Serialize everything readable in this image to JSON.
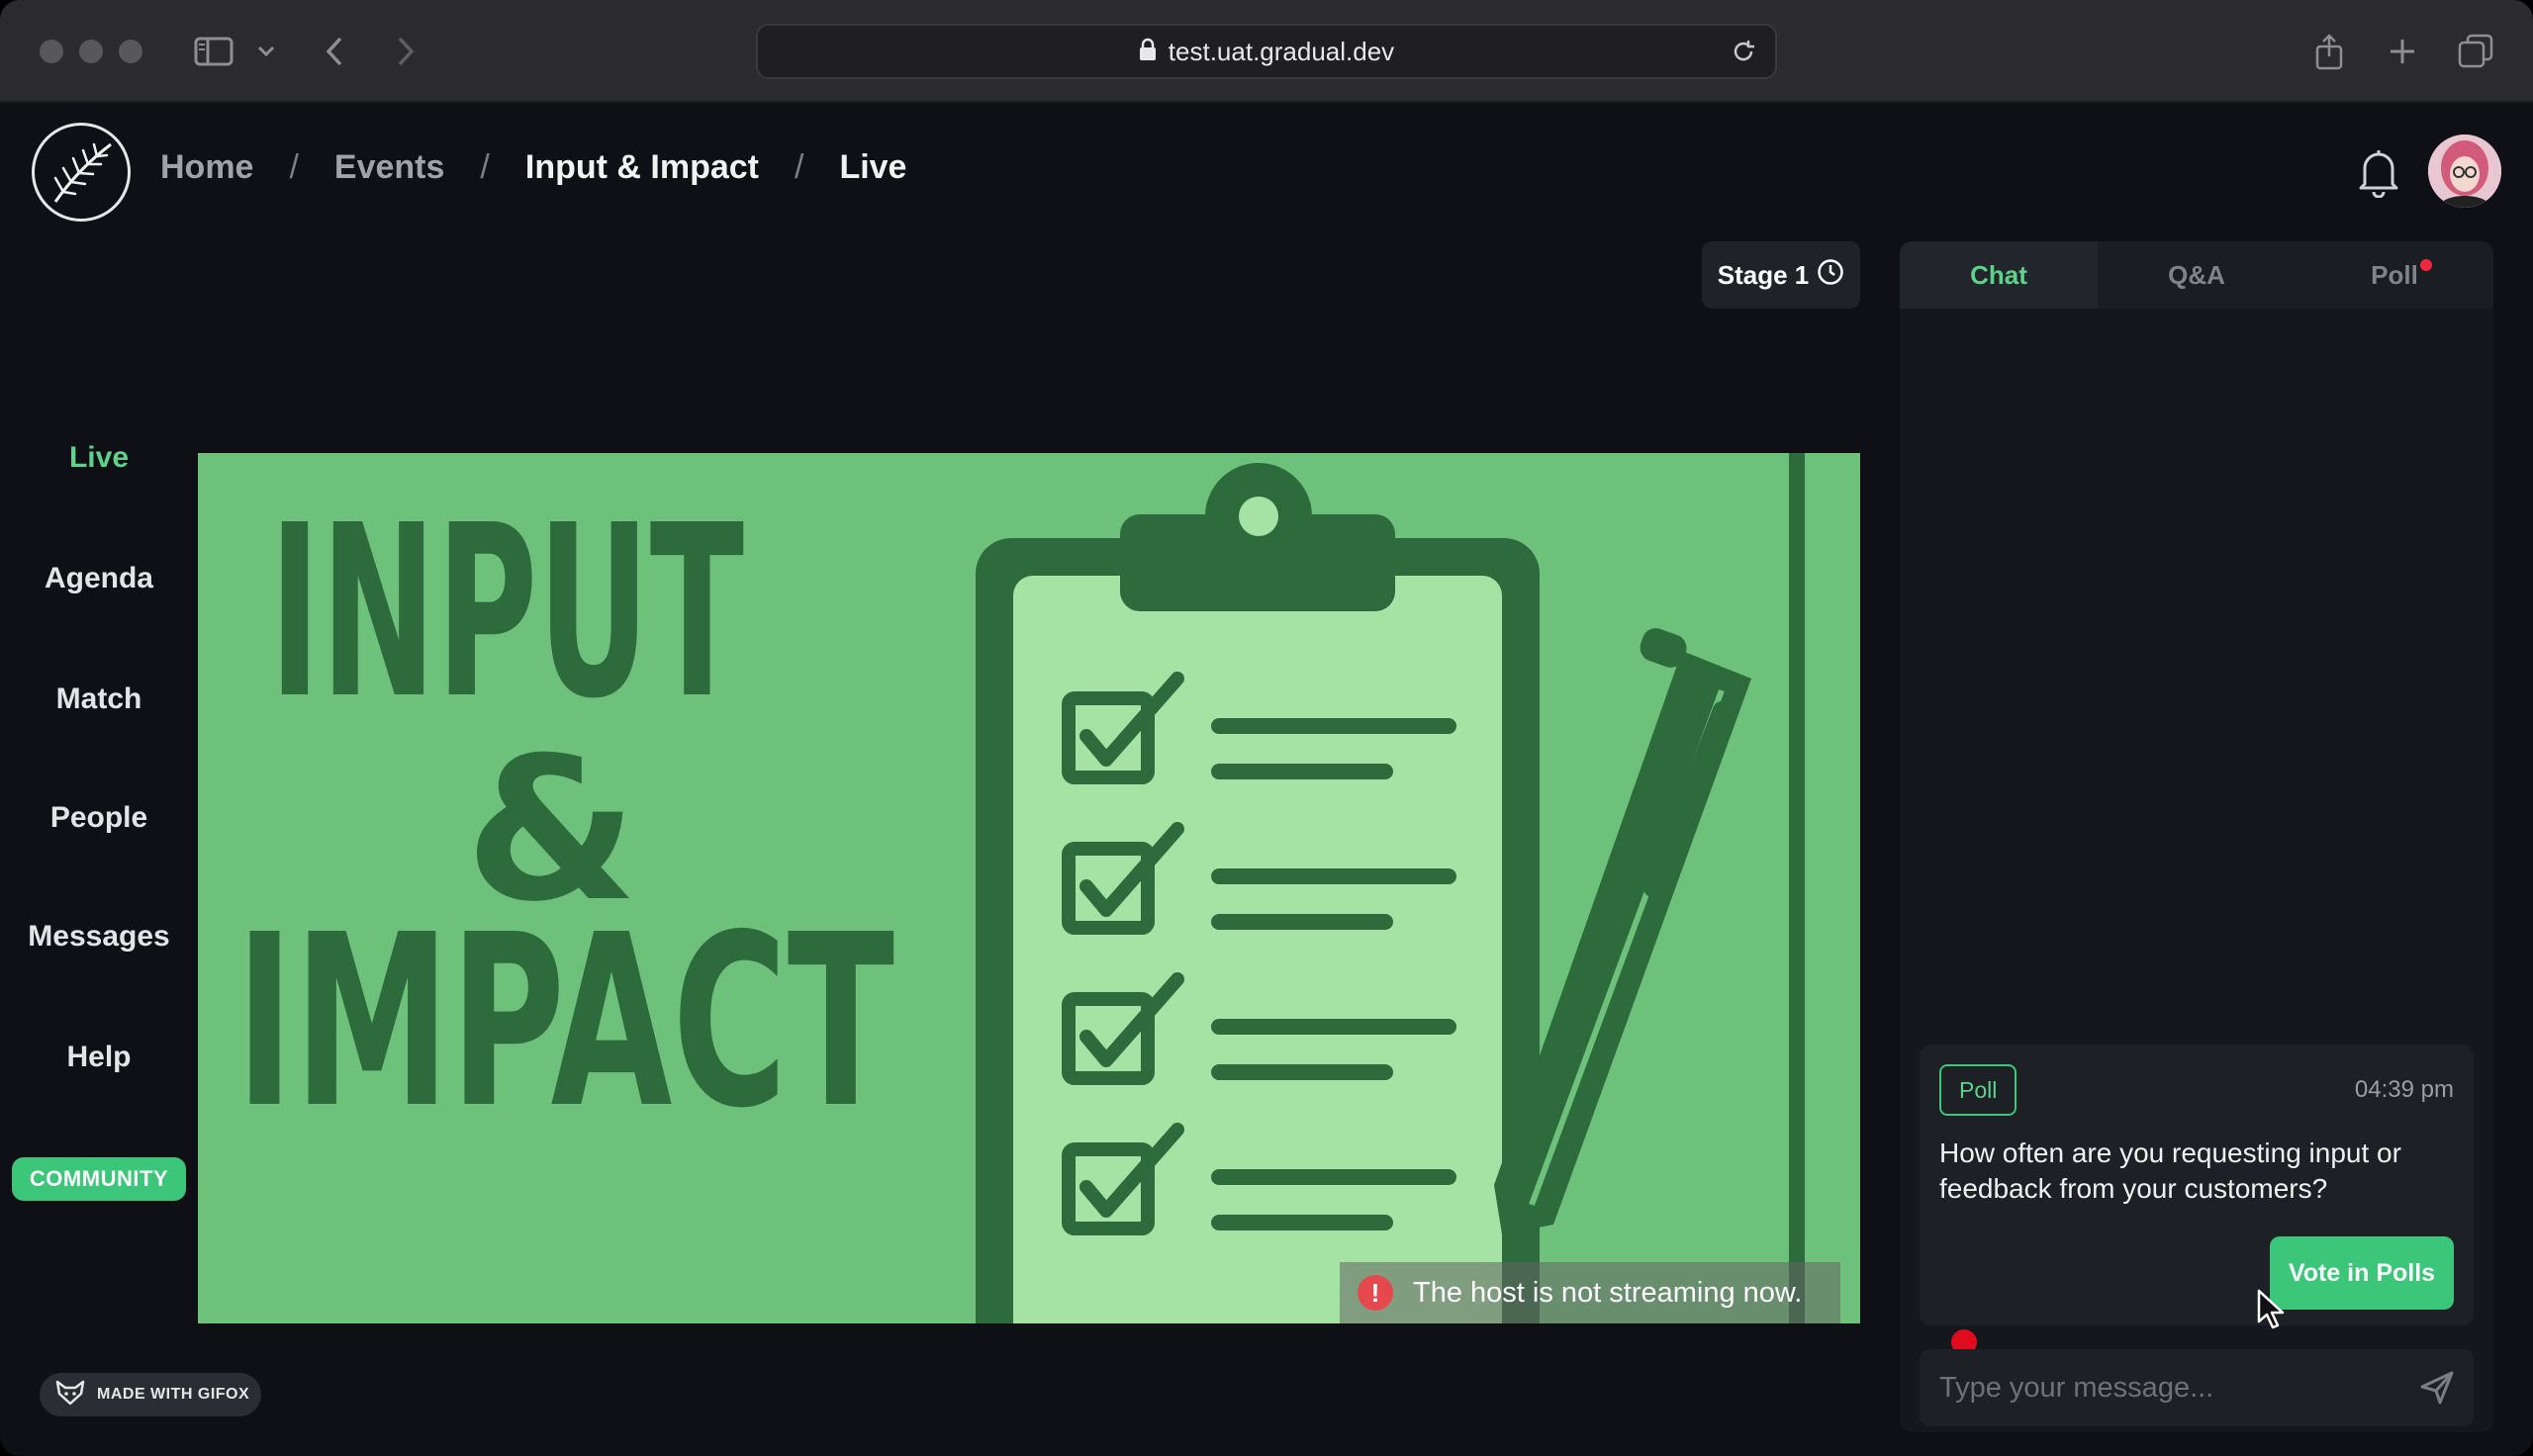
{
  "browser": {
    "url": "test.uat.gradual.dev"
  },
  "breadcrumb": [
    "Home",
    "Events",
    "Input & Impact",
    "Live"
  ],
  "nav": {
    "items": [
      "Live",
      "Agenda",
      "Match",
      "People",
      "Messages",
      "Help"
    ],
    "community": "COMMUNITY"
  },
  "stage": {
    "label": "Stage 1"
  },
  "video": {
    "title_line1": "INPUT",
    "title_line2": "&",
    "title_line3": "IMPACT",
    "status": "The host is not streaming now."
  },
  "panel": {
    "tabs": [
      "Chat",
      "Q&A",
      "Poll"
    ],
    "active_tab": "Chat",
    "poll_card": {
      "badge": "Poll",
      "time": "04:39 pm",
      "question": "How often are you requesting input or feedback from your customers?",
      "vote_button": "Vote in Polls"
    },
    "message_placeholder": "Type your message..."
  },
  "watermark": "MADE WITH GIFOX",
  "colors": {
    "accent": "#3bc679",
    "accent_text": "#5ed28a",
    "alert": "#f0283c",
    "video_bg": "#6dc17a",
    "video_dark": "#2d6b3c"
  }
}
